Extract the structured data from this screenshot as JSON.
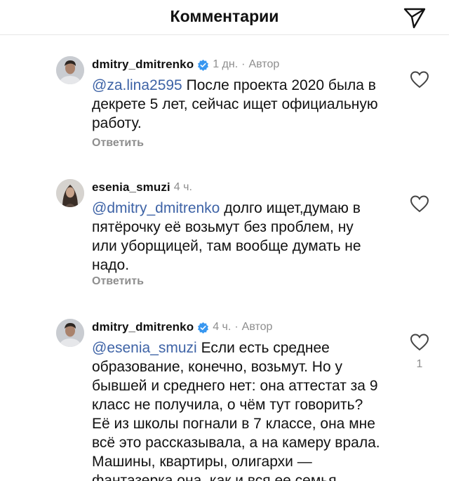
{
  "header": {
    "title": "Комментарии",
    "send_icon": "paper-plane-icon"
  },
  "comments": [
    {
      "username": "dmitry_dmitrenko",
      "verified": true,
      "time": "1 дн.",
      "separator": "·",
      "author_label": "Автор",
      "mention": "@za.lina2595",
      "lines": [
        "После проекта 2020 была в",
        "декрете 5 лет, сейчас ищет официальную",
        "работу."
      ],
      "reply_label": "Ответить",
      "like_icon": "heart-outline-icon"
    },
    {
      "username": "esenia_smuzi",
      "verified": false,
      "time": "4 ч.",
      "mention": "@dmitry_dmitrenko",
      "lines": [
        "долго ищет,думаю в",
        "пятёрочку её возьмут без проблем, ну",
        "или уборщицей, там вообще думать не",
        "надо."
      ],
      "reply_label": "Ответить",
      "like_icon": "heart-outline-icon"
    },
    {
      "username": "dmitry_dmitrenko",
      "verified": true,
      "time": "4 ч.",
      "separator": "·",
      "author_label": "Автор",
      "mention": "@esenia_smuzi",
      "lines": [
        "Если есть среднее",
        "образование, конечно, возьмут. Но у",
        "бывшей и среднего нет: она аттестат за 9",
        "класс не получила, о чём тут говорить?",
        "Её из школы погнали в 7 классе, она мне",
        "всё это рассказывала, а на камеру врала.",
        "Машины, квартиры, олигархи —",
        "фантазерка она, как и вся ее семья."
      ],
      "like_icon": "heart-outline-icon",
      "like_count": "1"
    }
  ],
  "colors": {
    "mention": "#3e63a6",
    "muted": "#8e8e8e",
    "verified": "#3897f0"
  }
}
